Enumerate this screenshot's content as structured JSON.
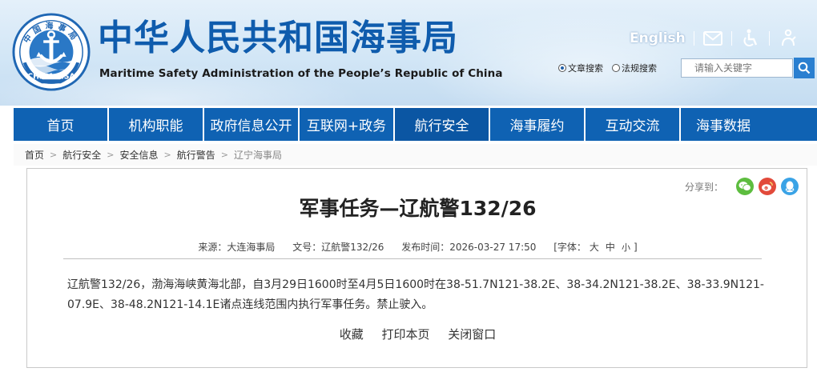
{
  "header": {
    "emblem_ring_text": "中国海事局",
    "emblem_bottom_text": "CHINA MSA",
    "title_cn": "中华人民共和国海事局",
    "title_en": "Maritime Safety Administration of the People’s Republic of China",
    "lang_link": "English",
    "tool_icons": [
      "mail-icon",
      "accessibility-icon",
      "elder-mode-icon"
    ],
    "search": {
      "options": [
        {
          "label": "文章搜索",
          "checked": true
        },
        {
          "label": "法规搜索",
          "checked": false
        }
      ],
      "placeholder": "请输入关键字",
      "button_icon": "search-icon"
    }
  },
  "nav": {
    "items": [
      "首页",
      "机构职能",
      "政府信息公开",
      "互联网+政务",
      "航行安全",
      "海事履约",
      "互动交流",
      "海事数据"
    ],
    "active_index": 4
  },
  "breadcrumb": {
    "items": [
      "首页",
      "航行安全",
      "安全信息",
      "航行警告"
    ],
    "current": "辽宁海事局",
    "separator": ">"
  },
  "article": {
    "share_label": "分享到：",
    "share_icons": [
      "wechat-icon",
      "weibo-icon",
      "qq-icon"
    ],
    "title": "军事任务—辽航警132/26",
    "meta": {
      "source": "来源：大连海事局",
      "doc_no": "文号：辽航警132/26",
      "publish_time": "发布时间：2026-03-27 17:50",
      "font_label_open": "[字体：",
      "font_large": "大",
      "font_medium": "中",
      "font_small": "小",
      "font_label_close": "]"
    },
    "body": "辽航警132/26，渤海海峡黄海北部，自3月29日1600时至4月5日1600时在38-51.7N121-38.2E、38-34.2N121-38.2E、38-33.9N121-07.9E、38-48.2N121-14.1E诸点连线范围内执行军事任务。禁止驶入。",
    "actions": [
      "收藏",
      "打印本页",
      "关闭窗口"
    ]
  },
  "colors": {
    "brand_blue": "#0f62b3",
    "title_blue": "#0f5cad",
    "search_button": "#2a7fd0"
  }
}
